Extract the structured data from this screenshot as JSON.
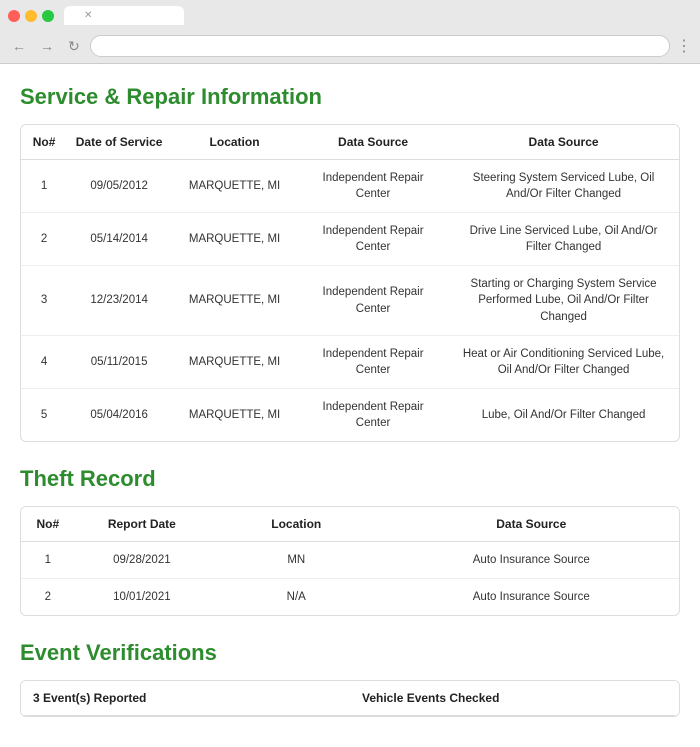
{
  "browser": {
    "tab_label": "",
    "address": "",
    "close_symbol": "✕",
    "back_symbol": "←",
    "forward_symbol": "→",
    "refresh_symbol": "↻",
    "menu_symbol": "⋮"
  },
  "service_section": {
    "title": "Service & Repair Information",
    "columns": [
      "No#",
      "Date of Service",
      "Location",
      "Data Source",
      "Data Source"
    ],
    "rows": [
      {
        "no": "1",
        "date": "09/05/2012",
        "location": "MARQUETTE, MI",
        "source1": "Independent Repair Center",
        "source2": "Steering System Serviced Lube, Oil And/Or Filter Changed"
      },
      {
        "no": "2",
        "date": "05/14/2014",
        "location": "MARQUETTE, MI",
        "source1": "Independent Repair Center",
        "source2": "Drive Line Serviced Lube, Oil And/Or Filter Changed"
      },
      {
        "no": "3",
        "date": "12/23/2014",
        "location": "MARQUETTE, MI",
        "source1": "Independent Repair Center",
        "source2": "Starting or Charging System Service Performed Lube, Oil And/Or Filter Changed"
      },
      {
        "no": "4",
        "date": "05/11/2015",
        "location": "MARQUETTE, MI",
        "source1": "Independent Repair Center",
        "source2": "Heat or Air Conditioning Serviced Lube, Oil And/Or Filter Changed"
      },
      {
        "no": "5",
        "date": "05/04/2016",
        "location": "MARQUETTE, MI",
        "source1": "Independent Repair Center",
        "source2": "Lube, Oil And/Or Filter Changed"
      }
    ]
  },
  "theft_section": {
    "title": "Theft Record",
    "columns": [
      "No#",
      "Report Date",
      "Location",
      "Data Source"
    ],
    "rows": [
      {
        "no": "1",
        "date": "09/28/2021",
        "location": "MN",
        "source": "Auto Insurance Source"
      },
      {
        "no": "2",
        "date": "10/01/2021",
        "location": "N/A",
        "source": "Auto Insurance Source"
      }
    ]
  },
  "event_section": {
    "title": "Event Verifications",
    "col1": "3 Event(s) Reported",
    "col2": "Vehicle Events Checked"
  }
}
